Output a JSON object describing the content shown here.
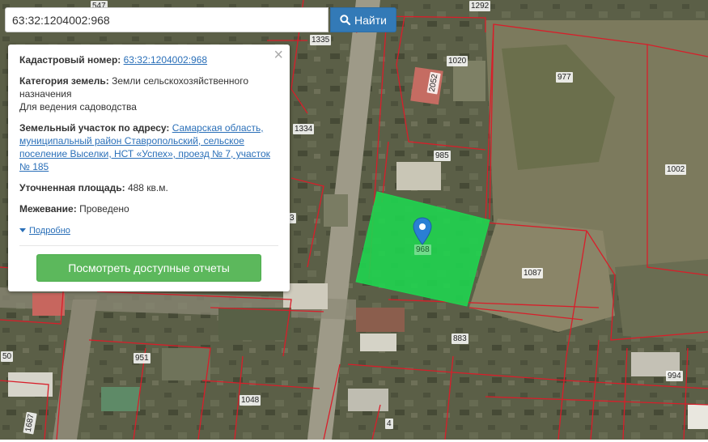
{
  "search": {
    "value": "63:32:1204002:968",
    "button_label": "Найти",
    "button_icon": "search-icon"
  },
  "colors": {
    "parcel_border": "#d81e2a",
    "selected_parcel": "#1fd44f",
    "primary_button": "#337ab7",
    "success_button": "#5cb85c",
    "link": "#2a6fb8"
  },
  "popup": {
    "cadastral_label": "Кадастровый номер:",
    "cadastral_value": "63:32:1204002:968",
    "category_label": "Категория земель:",
    "category_value": "Земли сельскохозяйственного назначения",
    "use_value": "Для ведения садоводства",
    "address_label": "Земельный участок по адресу:",
    "address_value": "Самарская область, муниципальный район Ставропольский, сельское поселение Выселки, НСТ «Успех», проезд № 7, участок № 185",
    "area_label": "Уточненная площадь:",
    "area_value": "488 кв.м.",
    "survey_label": "Межевание:",
    "survey_value": "Проведено",
    "more_link": "Подробно",
    "reports_button": "Посмотреть доступные отчеты",
    "close_icon": "close-icon"
  },
  "parcel_labels": [
    "547",
    "1292",
    "1335",
    "1020",
    "2052",
    "977",
    "1334",
    "985",
    "1002",
    "1087",
    "883",
    "951",
    "50",
    "994",
    "1048",
    "1687",
    "4",
    "968",
    "3"
  ],
  "marker_icon": "map-pin-icon"
}
